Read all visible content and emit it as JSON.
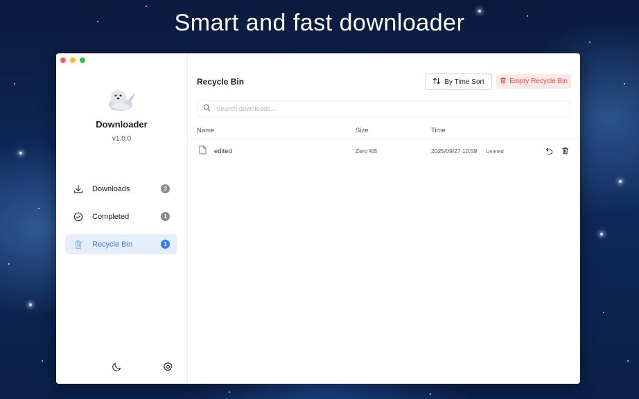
{
  "headline": "Smart and fast downloader",
  "app": {
    "name": "Downloader",
    "version": "v1.0.0"
  },
  "sidebar": {
    "items": [
      {
        "label": "Downloads",
        "count": "3",
        "icon": "download-icon",
        "active": false
      },
      {
        "label": "Completed",
        "count": "1",
        "icon": "check-circle-icon",
        "active": false
      },
      {
        "label": "Recycle Bin",
        "count": "1",
        "icon": "trash-icon",
        "active": true
      }
    ],
    "bottom_icons": [
      "moon-icon",
      "gear-icon"
    ]
  },
  "main": {
    "title": "Recycle Bin",
    "sort_label": "By Time Sort",
    "empty_label": "Empty Recycle Bin",
    "search_placeholder": "Search downloads...",
    "columns": {
      "name": "Name",
      "size": "Size",
      "time": "Time"
    },
    "rows": [
      {
        "name": "edited",
        "size": "Zero KB",
        "time": "2025/09/27 10:59",
        "status": "Deleted"
      }
    ]
  },
  "colors": {
    "accent": "#2f7df6",
    "danger": "#e5484d",
    "active_bg": "#e7eefb"
  }
}
